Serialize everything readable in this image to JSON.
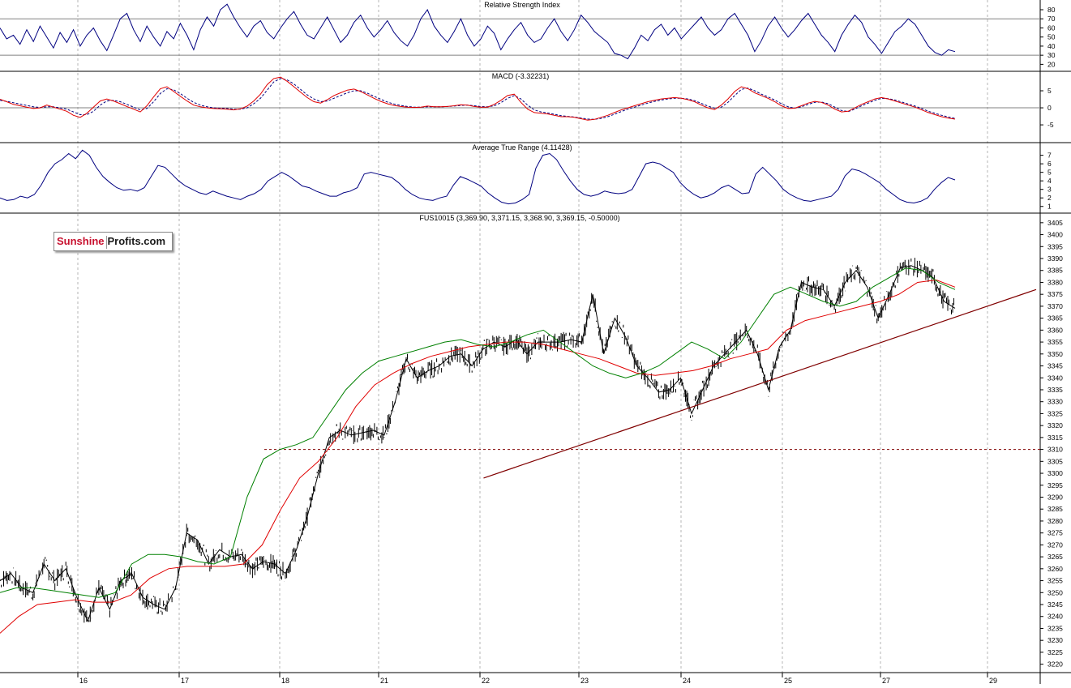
{
  "colors": {
    "price": "#000000",
    "indicator": "#000080",
    "ma_fast": "#008000",
    "ma_slow": "#e00000",
    "trend": "#800000",
    "grid": "#b4b4b4",
    "level": "#808080"
  },
  "logo": {
    "part1": "Sunshine",
    "part2": "Profits.com"
  },
  "chart_data": [
    {
      "type": "line",
      "title": "Relative Strength Index",
      "ylim": [
        15,
        88
      ],
      "yticks": [
        20,
        30,
        40,
        50,
        60,
        70,
        80
      ],
      "levels": [
        30,
        70
      ],
      "series": [
        {
          "values": [
            60,
            48,
            52,
            42,
            58,
            45,
            62,
            50,
            38,
            55,
            44,
            58,
            40,
            52,
            60,
            46,
            35,
            52,
            70,
            76,
            58,
            45,
            62,
            50,
            40,
            56,
            48,
            65,
            52,
            36,
            58,
            72,
            62,
            80,
            86,
            72,
            60,
            50,
            62,
            68,
            55,
            48,
            60,
            70,
            78,
            64,
            52,
            48,
            60,
            72,
            58,
            44,
            52,
            66,
            74,
            60,
            50,
            58,
            68,
            55,
            46,
            40,
            52,
            70,
            80,
            62,
            52,
            44,
            56,
            70,
            52,
            40,
            48,
            62,
            54,
            36,
            48,
            58,
            66,
            52,
            44,
            48,
            60,
            70,
            56,
            46,
            58,
            74,
            66,
            56,
            50,
            44,
            32,
            30,
            26,
            38,
            52,
            46,
            58,
            64,
            52,
            60,
            48,
            56,
            64,
            72,
            60,
            52,
            58,
            70,
            76,
            64,
            52,
            34,
            46,
            62,
            72,
            60,
            50,
            58,
            68,
            76,
            64,
            52,
            44,
            34,
            52,
            64,
            74,
            66,
            50,
            42,
            32,
            44,
            56,
            62,
            70,
            64,
            52,
            40,
            33,
            30,
            36,
            34
          ]
        }
      ]
    },
    {
      "type": "line",
      "title": "MACD (-3.32231)",
      "ylim": [
        -9.5,
        10
      ],
      "yticks": [
        -5,
        0,
        5
      ],
      "levels": [
        0
      ],
      "series": [
        {
          "values": [
            2.5,
            1.8,
            1.0,
            0.6,
            0.2,
            -0.2,
            0.0,
            0.8,
            0.2,
            -0.4,
            -1.0,
            -2.2,
            -2.8,
            -1.6,
            0.2,
            2.0,
            2.6,
            2.0,
            1.2,
            0.4,
            -0.4,
            -1.2,
            0.6,
            3.2,
            5.6,
            6.2,
            4.8,
            3.4,
            2.0,
            0.8,
            0.3,
            0.0,
            -0.2,
            -0.3,
            -0.4,
            -0.6,
            -0.3,
            0.5,
            2.0,
            4.0,
            6.8,
            8.6,
            9.0,
            7.8,
            6.2,
            4.6,
            3.0,
            1.8,
            1.4,
            2.4,
            3.6,
            4.4,
            5.2,
            5.5,
            4.8,
            3.8,
            2.8,
            1.9,
            1.2,
            0.7,
            0.4,
            0.2,
            0.1,
            0.2,
            0.5,
            0.3,
            0.3,
            0.4,
            0.6,
            0.9,
            0.8,
            0.4,
            0.2,
            0.2,
            1.0,
            2.2,
            3.6,
            4.0,
            1.6,
            -0.4,
            -1.4,
            -1.6,
            -1.8,
            -2.2,
            -2.6,
            -2.6,
            -2.8,
            -3.2,
            -3.6,
            -3.4,
            -2.8,
            -2.2,
            -1.4,
            -0.6,
            0.0,
            0.6,
            1.2,
            1.8,
            2.2,
            2.6,
            2.8,
            3.0,
            2.8,
            2.4,
            1.8,
            0.8,
            0.0,
            -0.5,
            0.8,
            2.6,
            4.8,
            6.2,
            5.6,
            4.4,
            3.6,
            2.8,
            1.8,
            0.6,
            -0.2,
            -0.1,
            0.6,
            1.4,
            1.9,
            1.6,
            0.8,
            -0.4,
            -1.2,
            -1.0,
            0.0,
            1.0,
            1.8,
            2.6,
            3.0,
            2.6,
            2.0,
            1.4,
            0.8,
            0.2,
            -0.6,
            -1.4,
            -2.0,
            -2.6,
            -3.0,
            -3.32231
          ]
        },
        {
          "values": [
            2.2,
            1.9,
            1.5,
            1.1,
            0.7,
            0.3,
            0.1,
            0.3,
            0.3,
            0.0,
            -0.4,
            -1.2,
            -2.0,
            -2.0,
            -1.0,
            0.8,
            2.0,
            2.2,
            1.8,
            1.0,
            0.2,
            -0.6,
            -0.2,
            1.8,
            4.2,
            5.6,
            5.3,
            4.2,
            2.8,
            1.6,
            0.8,
            0.3,
            0.0,
            -0.1,
            -0.2,
            -0.4,
            -0.4,
            0.0,
            1.2,
            2.8,
            5.2,
            7.6,
            8.6,
            8.2,
            7.0,
            5.4,
            3.8,
            2.6,
            1.8,
            2.0,
            2.8,
            3.6,
            4.4,
            5.0,
            5.0,
            4.3,
            3.4,
            2.5,
            1.7,
            1.1,
            0.7,
            0.4,
            0.2,
            0.2,
            0.3,
            0.3,
            0.3,
            0.4,
            0.5,
            0.7,
            0.8,
            0.6,
            0.4,
            0.3,
            0.6,
            1.5,
            2.8,
            3.6,
            2.6,
            0.8,
            -0.6,
            -1.2,
            -1.5,
            -1.9,
            -2.3,
            -2.5,
            -2.7,
            -3.0,
            -3.3,
            -3.4,
            -3.1,
            -2.6,
            -1.9,
            -1.1,
            -0.4,
            0.2,
            0.8,
            1.4,
            1.9,
            2.3,
            2.6,
            2.8,
            2.8,
            2.6,
            2.1,
            1.3,
            0.5,
            -0.1,
            0.2,
            1.6,
            3.6,
            5.4,
            5.8,
            5.0,
            4.0,
            3.2,
            2.3,
            1.2,
            0.3,
            -0.1,
            0.3,
            1.0,
            1.6,
            1.7,
            1.2,
            0.2,
            -0.8,
            -1.1,
            -0.4,
            0.6,
            1.4,
            2.2,
            2.8,
            2.7,
            2.3,
            1.7,
            1.1,
            0.5,
            -0.2,
            -1.0,
            -1.6,
            -2.2,
            -2.7,
            -3.1
          ]
        }
      ]
    },
    {
      "type": "line",
      "title": "Average True Range (4.11428)",
      "ylim": [
        0.5,
        8.2
      ],
      "yticks": [
        1,
        2,
        3,
        4,
        5,
        6,
        7
      ],
      "series": [
        {
          "values": [
            2.0,
            1.7,
            1.8,
            2.2,
            2.0,
            2.4,
            3.5,
            5.0,
            6.0,
            6.5,
            7.2,
            6.6,
            7.6,
            7.0,
            5.6,
            4.5,
            3.8,
            3.2,
            2.9,
            3.0,
            2.8,
            3.2,
            4.5,
            5.8,
            5.6,
            4.8,
            4.0,
            3.4,
            3.0,
            2.6,
            2.4,
            2.8,
            2.5,
            2.2,
            2.0,
            1.8,
            2.2,
            2.5,
            3.0,
            4.0,
            4.5,
            5.0,
            4.6,
            4.0,
            3.4,
            3.2,
            2.8,
            2.5,
            2.2,
            2.2,
            2.6,
            2.8,
            3.2,
            4.8,
            5.0,
            4.8,
            4.6,
            4.4,
            3.8,
            3.0,
            2.4,
            2.0,
            1.8,
            1.7,
            2.0,
            2.2,
            3.5,
            4.5,
            4.2,
            3.8,
            3.4,
            2.6,
            2.0,
            1.5,
            1.3,
            1.4,
            1.8,
            2.4,
            5.5,
            7.0,
            7.2,
            6.5,
            5.2,
            4.0,
            3.0,
            2.4,
            2.2,
            2.4,
            2.8,
            2.6,
            2.5,
            2.6,
            3.0,
            4.5,
            6.0,
            6.2,
            6.0,
            5.5,
            5.0,
            3.8,
            3.0,
            2.4,
            2.0,
            2.2,
            2.6,
            3.2,
            3.5,
            3.0,
            2.5,
            2.6,
            4.8,
            5.6,
            4.8,
            4.0,
            3.0,
            2.4,
            2.0,
            1.7,
            1.6,
            1.8,
            2.0,
            2.2,
            3.0,
            4.6,
            5.4,
            5.2,
            4.8,
            4.3,
            3.8,
            3.0,
            2.4,
            1.8,
            1.5,
            1.4,
            1.6,
            2.0,
            3.0,
            3.8,
            4.4,
            4.11428
          ]
        }
      ]
    },
    {
      "type": "line",
      "title": "FUS10015 (3,369.90, 3,371.15, 3,368.90, 3,369.15, -0.50000)",
      "ylim": [
        3217.5,
        3408
      ],
      "yticks": [
        3220,
        3225,
        3230,
        3235,
        3240,
        3245,
        3250,
        3255,
        3260,
        3265,
        3270,
        3275,
        3280,
        3285,
        3290,
        3295,
        3300,
        3305,
        3310,
        3315,
        3320,
        3325,
        3330,
        3335,
        3340,
        3345,
        3350,
        3355,
        3360,
        3365,
        3370,
        3375,
        3380,
        3385,
        3390,
        3395,
        3400,
        3405
      ],
      "x_labels": [
        "16",
        "17",
        "18",
        "21",
        "22",
        "23",
        "24",
        "25",
        "27",
        "29"
      ],
      "series": [
        {
          "values": [
            3255,
            3258,
            3252,
            3250,
            3262,
            3255,
            3260,
            3248,
            3238,
            3252,
            3243,
            3255,
            3258,
            3248,
            3245,
            3243,
            3252,
            3275,
            3272,
            3262,
            3268,
            3265,
            3266,
            3260,
            3263,
            3262,
            3258,
            3268,
            3282,
            3300,
            3315,
            3318,
            3316,
            3317,
            3318,
            3316,
            3330,
            3348,
            3340,
            3343,
            3345,
            3349,
            3350,
            3345,
            3352,
            3355,
            3353,
            3356,
            3350,
            3355,
            3355,
            3355,
            3356,
            3355,
            3375,
            3350,
            3365,
            3357,
            3345,
            3340,
            3334,
            3335,
            3340,
            3325,
            3335,
            3345,
            3350,
            3355,
            3360,
            3350,
            3335,
            3353,
            3360,
            3380,
            3378,
            3377,
            3370,
            3380,
            3385,
            3378,
            3365,
            3375,
            3386,
            3387,
            3385,
            3382,
            3372,
            3369.15
          ]
        },
        {
          "values": [
            3250,
            3252,
            3252,
            3251,
            3250,
            3249,
            3248,
            3250,
            3262,
            3266,
            3266,
            3265,
            3263,
            3262,
            3265,
            3290,
            3306,
            3310,
            3312,
            3315,
            3325,
            3335,
            3342,
            3347,
            3349,
            3351,
            3353,
            3355,
            3356,
            3354,
            3353,
            3355,
            3358,
            3360,
            3355,
            3350,
            3345,
            3342,
            3340,
            3342,
            3345,
            3350,
            3355,
            3352,
            3348,
            3355,
            3365,
            3375,
            3378,
            3375,
            3372,
            3370,
            3372,
            3378,
            3382,
            3386,
            3385,
            3380,
            3377
          ]
        },
        {
          "values": [
            3233,
            3240,
            3245,
            3246,
            3247,
            3246,
            3246,
            3249,
            3256,
            3260,
            3261,
            3261,
            3261,
            3262,
            3270,
            3285,
            3298,
            3305,
            3315,
            3328,
            3337,
            3342,
            3346,
            3349,
            3351,
            3353,
            3354,
            3355,
            3355,
            3354,
            3352,
            3350,
            3348,
            3345,
            3342,
            3341,
            3342,
            3343,
            3345,
            3348,
            3350,
            3352,
            3360,
            3364,
            3366,
            3368,
            3370,
            3372,
            3375,
            3380,
            3381,
            3378
          ]
        }
      ],
      "levels": [
        3310
      ],
      "trendline": [
        [
          0.466,
          3298
        ],
        [
          1,
          3377
        ]
      ]
    }
  ]
}
